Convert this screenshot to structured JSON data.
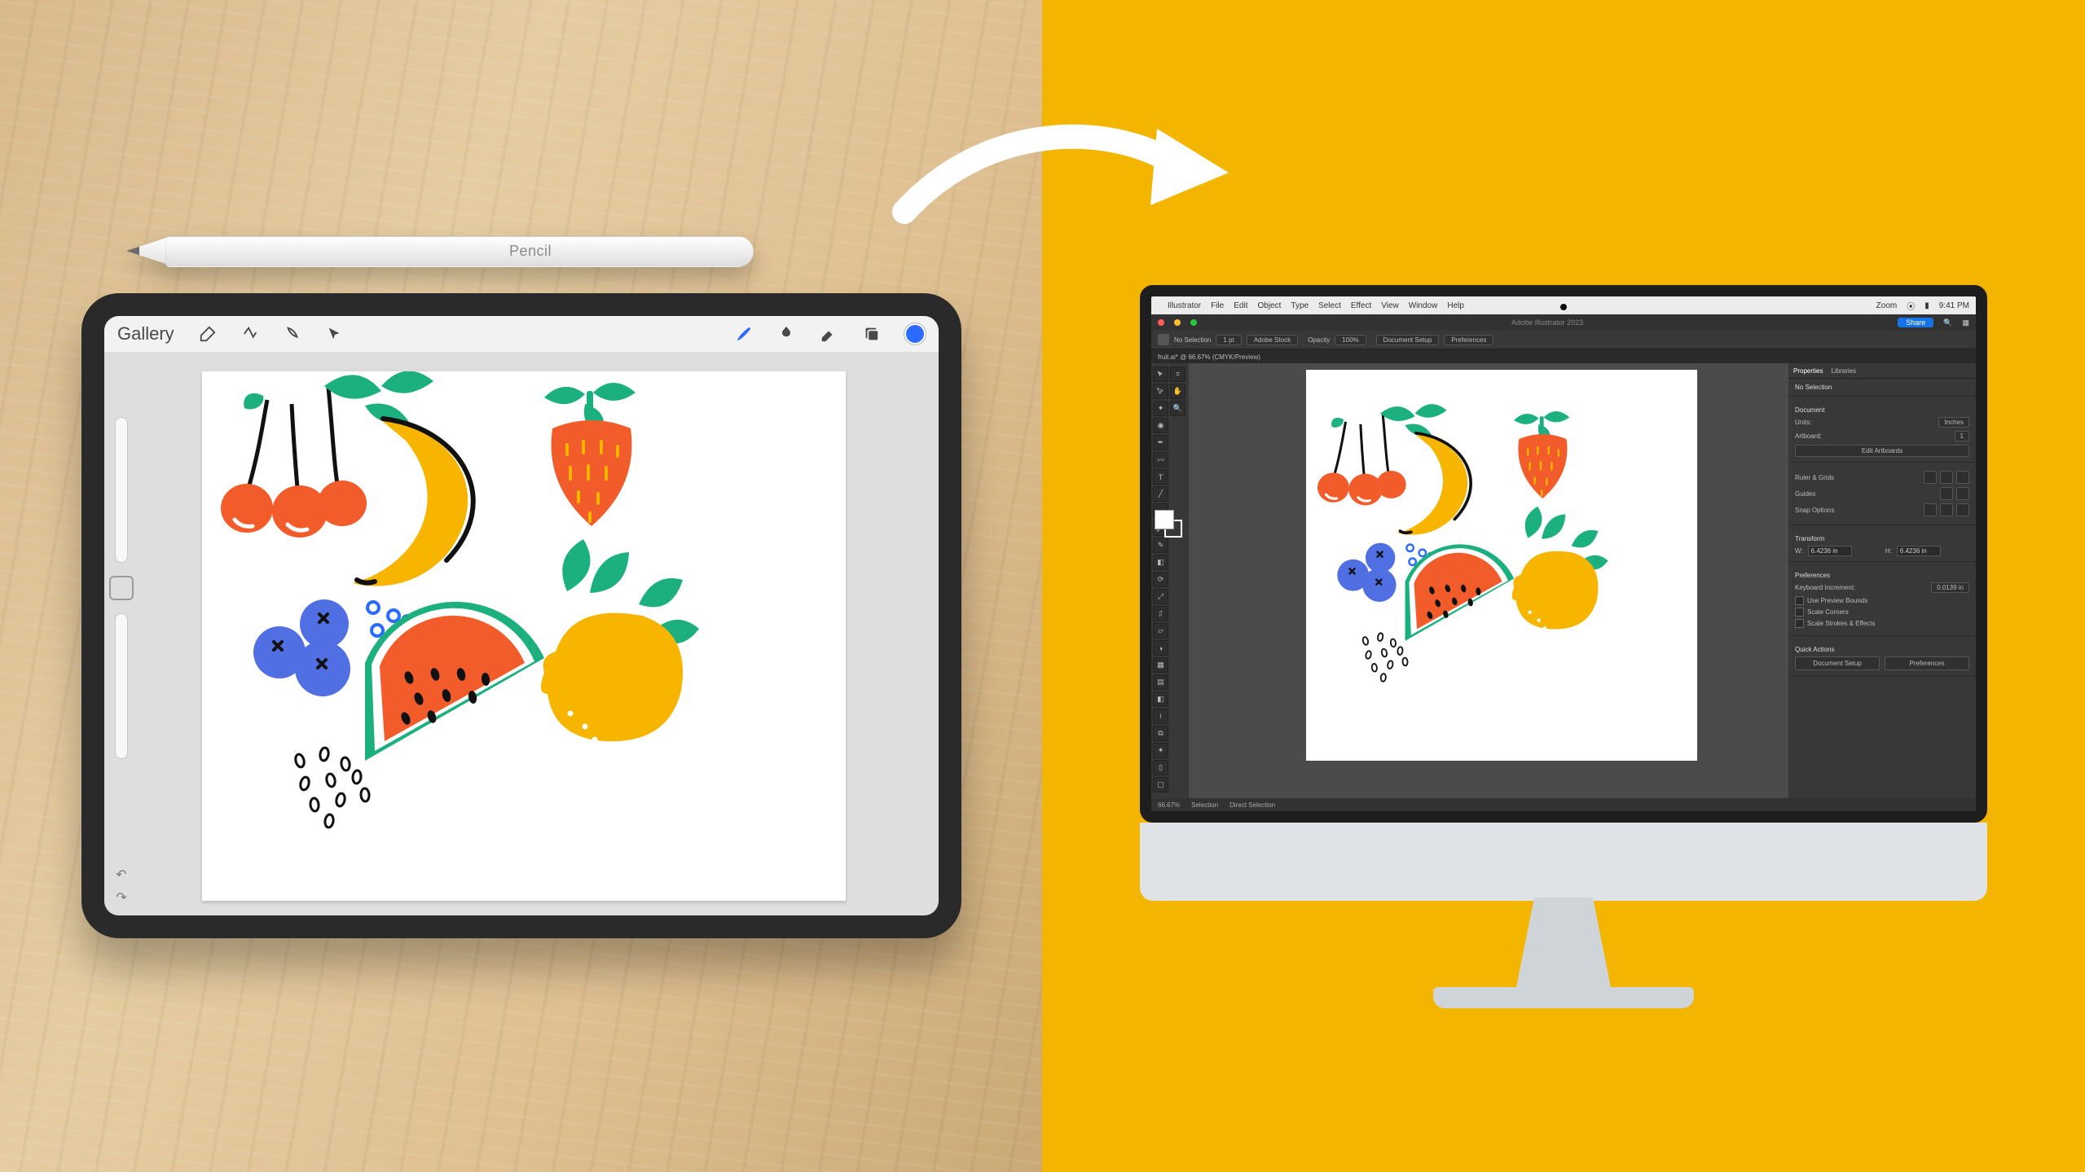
{
  "pencil_label": "Pencil",
  "procreate": {
    "gallery": "Gallery"
  },
  "mac_menu": {
    "items": [
      "Illustrator",
      "File",
      "Edit",
      "Object",
      "Type",
      "Select",
      "Effect",
      "View",
      "Window",
      "Help"
    ],
    "zoom": "Zoom",
    "time": "9:41 PM"
  },
  "ai_menu": {
    "share": "Share"
  },
  "ai_ctrl": {
    "pills": [
      "Adobe Stock",
      "100%"
    ],
    "perc": "100%",
    "labels": [
      "Document Setup",
      "Preferences"
    ]
  },
  "ai_tab": {
    "name": "fruit.ai* @ 66.67% (CMYK/Preview)"
  },
  "panels": {
    "tabs": [
      "Properties",
      "Libraries"
    ],
    "no_selection": "No Selection",
    "document": "Document",
    "units": "Units:",
    "units_val": "Inches",
    "artboard": "Artboard:",
    "artboard_val": "1",
    "edit_artboards": "Edit Artboards",
    "ruler_grid": "Ruler & Grids",
    "guides": "Guides",
    "snap": "Snap Options",
    "bounds": "Transform",
    "w": "W:",
    "h": "H:",
    "wv": "6.4236 in",
    "hv": "6.4236 in",
    "prefs": "Preferences",
    "key_inc": "Keyboard Increment:",
    "key_inc_v": "0.0139 in",
    "use_preview": "Use Preview Bounds",
    "scale_corners": "Scale Corners",
    "scale_strokes": "Scale Strokes & Effects",
    "quick": "Quick Actions",
    "doc_setup": "Document Setup",
    "prefs_btn": "Preferences"
  },
  "status": {
    "zoom": "66.67%",
    "tool": "Selection",
    "extra": "Direct Selection"
  }
}
